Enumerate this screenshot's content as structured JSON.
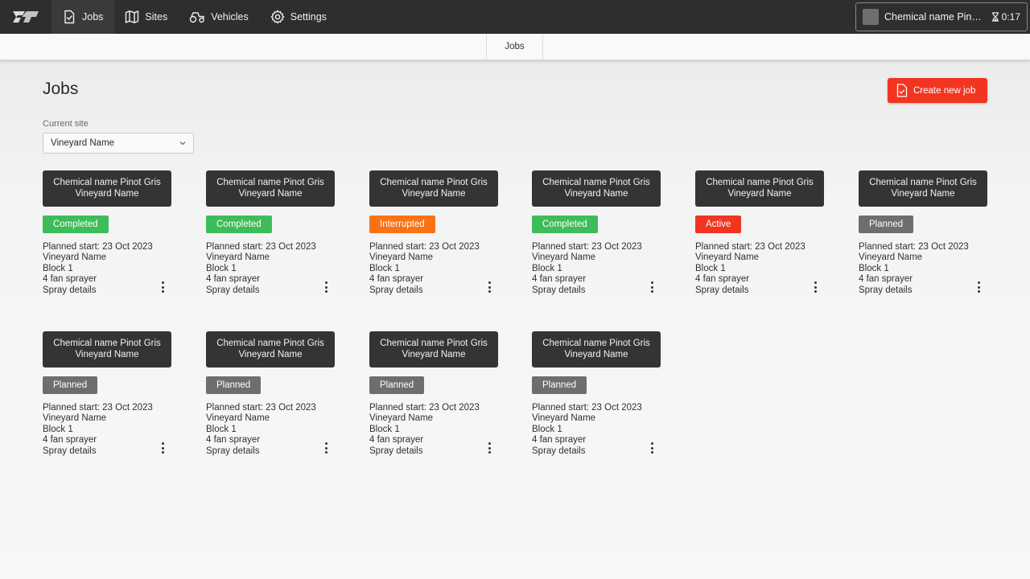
{
  "nav": {
    "items": [
      {
        "label": "Jobs",
        "icon": "jobs-document-check-icon",
        "active": true
      },
      {
        "label": "Sites",
        "icon": "map-icon",
        "active": false
      },
      {
        "label": "Vehicles",
        "icon": "tractor-icon",
        "active": false
      },
      {
        "label": "Settings",
        "icon": "gear-icon",
        "active": false
      }
    ],
    "user_name": "Chemical name Pinot ...",
    "timer": "0:17"
  },
  "subnav": {
    "tab": "Jobs"
  },
  "page": {
    "title": "Jobs",
    "create_button": "Create new job",
    "site_label": "Current site",
    "site_value": "Vineyard Name"
  },
  "colors": {
    "Completed": "#3ebc5a",
    "Interrupted": "#f97316",
    "Active": "#f2351f",
    "Planned": "#6e6e6e",
    "accent": "#f2351f"
  },
  "jobs": [
    {
      "title": "Chemical name Pinot Gris Vineyard Name",
      "status": "Completed",
      "planned_start": "Planned start: 23 Oct 2023",
      "site": "Vineyard Name",
      "block": "Block 1",
      "vehicle": "4 fan sprayer",
      "spray": "Spray details"
    },
    {
      "title": "Chemical name Pinot Gris Vineyard Name",
      "status": "Completed",
      "planned_start": "Planned start: 23 Oct 2023",
      "site": "Vineyard Name",
      "block": "Block 1",
      "vehicle": "4 fan sprayer",
      "spray": "Spray details"
    },
    {
      "title": "Chemical name Pinot Gris Vineyard Name",
      "status": "Interrupted",
      "planned_start": "Planned start: 23 Oct 2023",
      "site": "Vineyard Name",
      "block": "Block 1",
      "vehicle": "4 fan sprayer",
      "spray": "Spray details"
    },
    {
      "title": "Chemical name Pinot Gris Vineyard Name",
      "status": "Completed",
      "planned_start": "Planned start: 23 Oct 2023",
      "site": "Vineyard Name",
      "block": "Block 1",
      "vehicle": "4 fan sprayer",
      "spray": "Spray details"
    },
    {
      "title": "Chemical name Pinot Gris Vineyard Name",
      "status": "Active",
      "planned_start": "Planned start: 23 Oct 2023",
      "site": "Vineyard Name",
      "block": "Block 1",
      "vehicle": "4 fan sprayer",
      "spray": "Spray details"
    },
    {
      "title": "Chemical name Pinot Gris Vineyard Name",
      "status": "Planned",
      "planned_start": "Planned start: 23 Oct 2023",
      "site": "Vineyard Name",
      "block": "Block 1",
      "vehicle": "4 fan sprayer",
      "spray": "Spray details"
    },
    {
      "title": "Chemical name Pinot Gris Vineyard Name",
      "status": "Planned",
      "planned_start": "Planned start: 23 Oct 2023",
      "site": "Vineyard Name",
      "block": "Block 1",
      "vehicle": "4 fan sprayer",
      "spray": "Spray details"
    },
    {
      "title": "Chemical name Pinot Gris Vineyard Name",
      "status": "Planned",
      "planned_start": "Planned start: 23 Oct 2023",
      "site": "Vineyard Name",
      "block": "Block 1",
      "vehicle": "4 fan sprayer",
      "spray": "Spray details"
    },
    {
      "title": "Chemical name Pinot Gris Vineyard Name",
      "status": "Planned",
      "planned_start": "Planned start: 23 Oct 2023",
      "site": "Vineyard Name",
      "block": "Block 1",
      "vehicle": "4 fan sprayer",
      "spray": "Spray details"
    },
    {
      "title": "Chemical name Pinot Gris Vineyard Name",
      "status": "Planned",
      "planned_start": "Planned start: 23 Oct 2023",
      "site": "Vineyard Name",
      "block": "Block 1",
      "vehicle": "4 fan sprayer",
      "spray": "Spray details"
    }
  ]
}
